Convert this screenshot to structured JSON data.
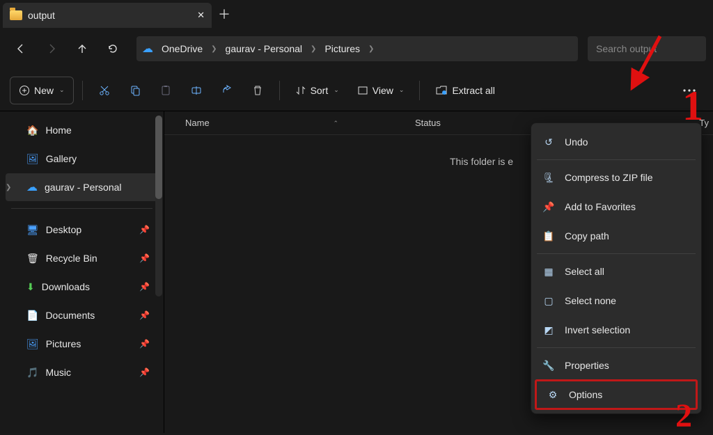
{
  "tab": {
    "title": "output"
  },
  "breadcrumb": {
    "items": [
      "OneDrive",
      "gaurav - Personal",
      "Pictures"
    ]
  },
  "search": {
    "placeholder": "Search output"
  },
  "toolbar": {
    "new": "New",
    "sort": "Sort",
    "view": "View",
    "extract": "Extract all"
  },
  "sidebar": {
    "home": "Home",
    "gallery": "Gallery",
    "personal": "gaurav - Personal",
    "desktop": "Desktop",
    "recycle": "Recycle Bin",
    "downloads": "Downloads",
    "documents": "Documents",
    "pictures": "Pictures",
    "music": "Music"
  },
  "columns": {
    "name": "Name",
    "status": "Status",
    "type": "Ty"
  },
  "empty_text": "This folder is e",
  "menu": {
    "undo": "Undo",
    "compress": "Compress to ZIP file",
    "favorites": "Add to Favorites",
    "copypath": "Copy path",
    "selectall": "Select all",
    "selectnone": "Select none",
    "invert": "Invert selection",
    "properties": "Properties",
    "options": "Options"
  },
  "annotations": {
    "one": "1",
    "two": "2"
  }
}
